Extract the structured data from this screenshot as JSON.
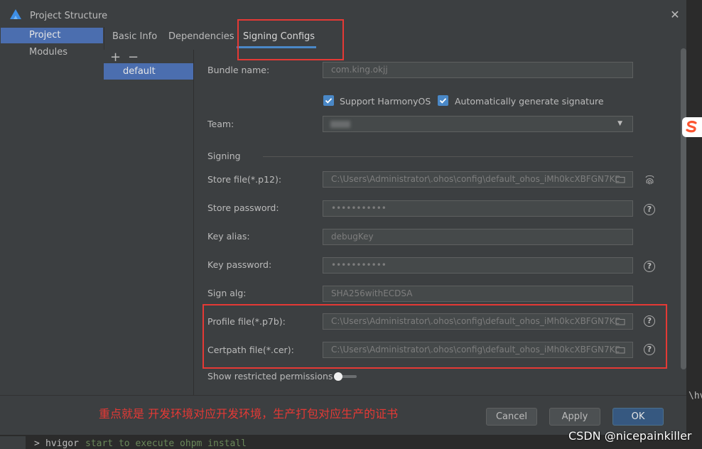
{
  "window": {
    "title": "Project Structure"
  },
  "nav": {
    "items": [
      {
        "label": "Project",
        "selected": true
      },
      {
        "label": "Modules",
        "selected": false
      }
    ]
  },
  "tabs": [
    {
      "label": "Basic Info"
    },
    {
      "label": "Dependencies"
    },
    {
      "label": "Signing Configs",
      "active": true
    }
  ],
  "configs": {
    "add": "+",
    "remove": "−",
    "items": [
      {
        "label": "default"
      }
    ]
  },
  "form": {
    "bundle_name": {
      "label": "Bundle name:",
      "value": "com.king.okjj"
    },
    "support_harmony": {
      "label": "Support HarmonyOS",
      "checked": true
    },
    "auto_sign": {
      "label": "Automatically generate signature",
      "checked": true
    },
    "team": {
      "label": "Team:",
      "value": ""
    },
    "signing_section": "Signing",
    "store_file": {
      "label": "Store file(*.p12):",
      "value": "C:\\Users\\Administrator\\.ohos\\config\\default_ohos_iMh0kcXBFGN7Kc"
    },
    "store_password": {
      "label": "Store password:",
      "value": "•••••••••••"
    },
    "key_alias": {
      "label": "Key alias:",
      "value": "debugKey"
    },
    "key_password": {
      "label": "Key password:",
      "value": "•••••••••••"
    },
    "sign_alg": {
      "label": "Sign alg:",
      "value": "SHA256withECDSA"
    },
    "profile_file": {
      "label": "Profile file(*.p7b):",
      "value": "C:\\Users\\Administrator\\.ohos\\config\\default_ohos_iMh0kcXBFGN7Kc"
    },
    "certpath_file": {
      "label": "Certpath file(*.cer):",
      "value": "C:\\Users\\Administrator\\.ohos\\config\\default_ohos_iMh0kcXBFGN7Kc"
    },
    "restricted": {
      "label": "Show restricted permissions",
      "on": false
    }
  },
  "buttons": {
    "cancel": "Cancel",
    "apply": "Apply",
    "ok": "OK"
  },
  "annotation": "重点就是 开发环境对应开发环境，生产打包对应生产的证书",
  "terminal": {
    "prompt": ">",
    "cmd": "hvigor",
    "rest": "start to execute ohpm install",
    "right_text": "\\hv"
  },
  "watermark": "CSDN @nicepainkiller",
  "colors": {
    "accent": "#4a88c7",
    "selection": "#4b6eaf",
    "annotation": "#e53935"
  }
}
